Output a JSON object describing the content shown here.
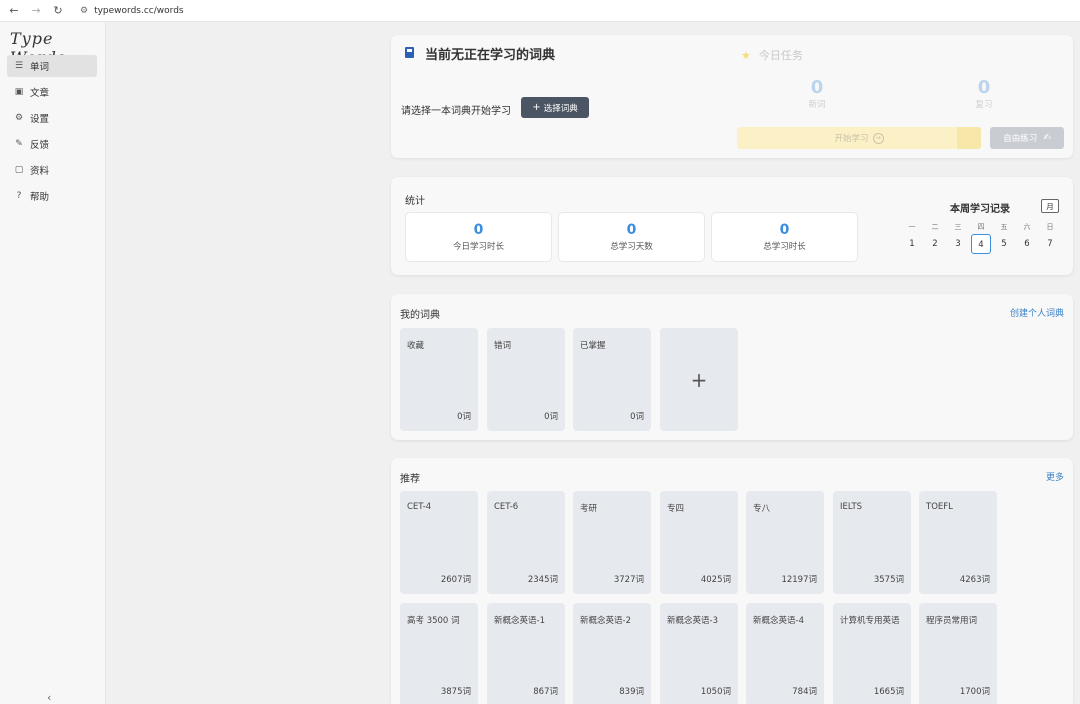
{
  "browser": {
    "url": "typewords.cc/words"
  },
  "sidebar": {
    "logo": "Type Words",
    "items": [
      {
        "label": "单词",
        "icon": "list-icon"
      },
      {
        "label": "文章",
        "icon": "article-icon"
      },
      {
        "label": "设置",
        "icon": "gear-icon"
      },
      {
        "label": "反馈",
        "icon": "feedback-icon"
      },
      {
        "label": "资料",
        "icon": "file-icon"
      },
      {
        "label": "帮助",
        "icon": "help-icon"
      }
    ],
    "collapse": "‹"
  },
  "current": {
    "title": "当前无正在学习的词典",
    "prompt": "请选择一本词典开始学习",
    "select_button": "选择词典",
    "task_title": "今日任务",
    "new_count": "0",
    "new_label": "新词",
    "review_count": "0",
    "review_label": "复习",
    "start_label": "开始学习",
    "free_label": "自由练习"
  },
  "stats": {
    "title": "统计",
    "items": [
      {
        "value": "0",
        "label": "今日学习时长"
      },
      {
        "value": "0",
        "label": "总学习天数"
      },
      {
        "value": "0",
        "label": "总学习时长"
      }
    ],
    "week_title": "本周学习记录",
    "month_button": "月",
    "weekdays": [
      "一",
      "二",
      "三",
      "四",
      "五",
      "六",
      "日"
    ],
    "days": [
      "1",
      "2",
      "3",
      "4",
      "5",
      "6",
      "7"
    ],
    "today": "4"
  },
  "my_dicts": {
    "title": "我的词典",
    "create_link": "创建个人词典",
    "items": [
      {
        "name": "收藏",
        "count": "0词"
      },
      {
        "name": "错词",
        "count": "0词"
      },
      {
        "name": "已掌握",
        "count": "0词"
      }
    ],
    "add_symbol": "+"
  },
  "recommend": {
    "title": "推荐",
    "more_link": "更多",
    "row1": [
      {
        "name": "CET-4",
        "count": "2607词"
      },
      {
        "name": "CET-6",
        "count": "2345词"
      },
      {
        "name": "考研",
        "count": "3727词"
      },
      {
        "name": "专四",
        "count": "4025词"
      },
      {
        "name": "专八",
        "count": "12197词"
      },
      {
        "name": "IELTS",
        "count": "3575词"
      },
      {
        "name": "TOEFL",
        "count": "4263词"
      }
    ],
    "row2": [
      {
        "name": "高考 3500 词",
        "count": "3875词"
      },
      {
        "name": "新概念英语-1",
        "count": "867词"
      },
      {
        "name": "新概念英语-2",
        "count": "839词"
      },
      {
        "name": "新概念英语-3",
        "count": "1050词"
      },
      {
        "name": "新概念英语-4",
        "count": "784词"
      },
      {
        "name": "计算机专用英语",
        "count": "1665词"
      },
      {
        "name": "程序员常用词",
        "count": "1700词"
      }
    ]
  }
}
